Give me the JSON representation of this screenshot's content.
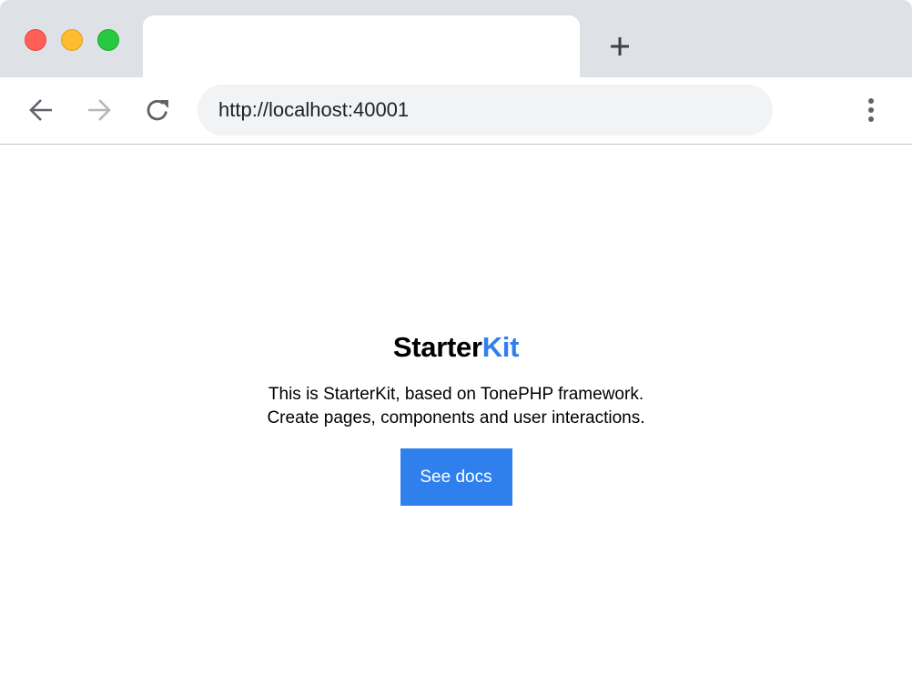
{
  "browser": {
    "new_tab_icon": "plus-icon",
    "nav": {
      "back_icon": "arrow-left-icon",
      "forward_icon": "arrow-right-icon",
      "reload_icon": "reload-icon",
      "menu_icon": "kebab-menu-icon"
    },
    "address": "http://localhost:40001",
    "colors": {
      "close": "#ff5f57",
      "minimize": "#febc2e",
      "maximize": "#28c840",
      "tabbar": "#dee1e6",
      "omnibox": "#f1f3f4"
    }
  },
  "page": {
    "brand_part1": "Starter",
    "brand_part2": "Kit",
    "description_line1": "This is StarterKit, based on TonePHP framework.",
    "description_line2": "Create pages, components and user interactions.",
    "cta_label": "See docs",
    "accent_color": "#2f80ed"
  }
}
